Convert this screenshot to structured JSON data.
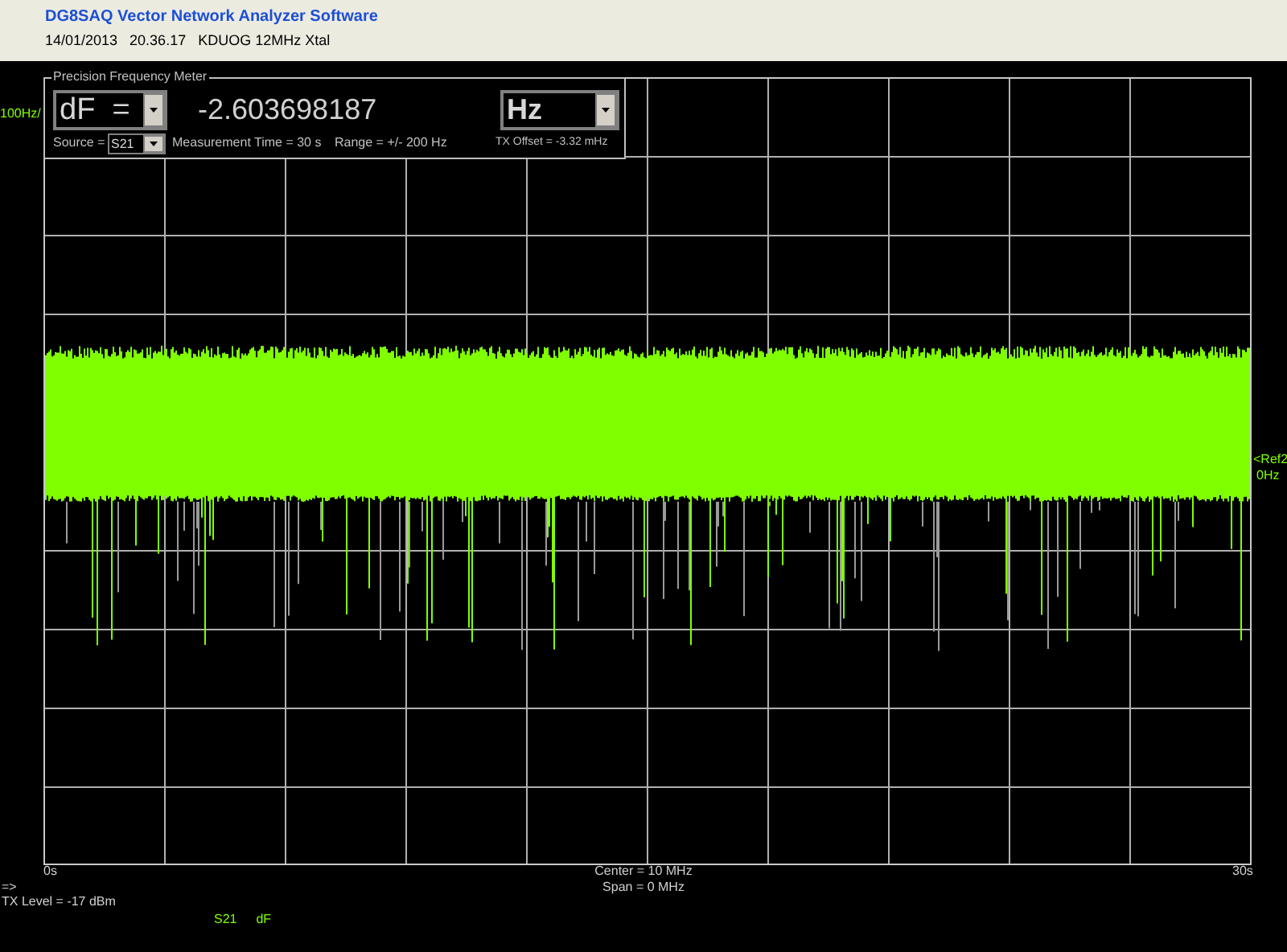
{
  "window": {
    "title": "DG8SAQ Vector Network Analyzer Software",
    "subtitle": "14/01/2013   20.36.17   KDUOG 12MHz Xtal"
  },
  "meter": {
    "title": "Precision Frequency Meter",
    "quantity": "dF  =",
    "value": "-2.603698187",
    "unit": "Hz",
    "source_label": "Source =",
    "source": "S21",
    "measurement_time": "Measurement Time = 30 s",
    "range": "Range = +/- 200 Hz",
    "tx_offset": "TX Offset = -3.32 mHz"
  },
  "axis": {
    "y_scale": "100Hz/",
    "ref_marker": "<Ref2",
    "ref_value": "0Hz",
    "x_start": "0s",
    "center": "Center = 10 MHz",
    "span": "Span = 0 MHz",
    "x_end": "30s"
  },
  "footer": {
    "prompt": "=>",
    "tx_level": "TX Level = -17 dBm",
    "traces": [
      {
        "label": "S21"
      },
      {
        "label": "dF"
      }
    ]
  }
}
